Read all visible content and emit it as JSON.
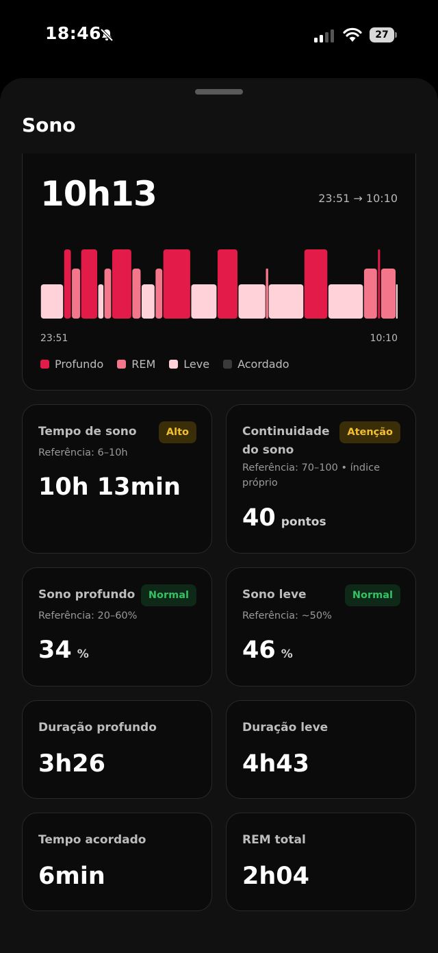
{
  "status_bar": {
    "time": "18:46",
    "battery": "27",
    "icons": [
      "bell-slash-icon",
      "signal-icon",
      "wifi-icon",
      "battery-icon"
    ]
  },
  "sheet": {
    "title": "Sono"
  },
  "summary": {
    "duration": "10h13",
    "range": "23:51 → 10:10",
    "start_label": "23:51",
    "end_label": "10:10",
    "legend": [
      {
        "label": "Profundo",
        "color": "#E31B48"
      },
      {
        "label": "REM",
        "color": "#F4768B"
      },
      {
        "label": "Leve",
        "color": "#FFD1D9"
      },
      {
        "label": "Acordado",
        "color": "#3A3A3A"
      }
    ]
  },
  "hypnogram": [
    {
      "s": "leve",
      "d": 30
    },
    {
      "s": "profundo",
      "d": 10
    },
    {
      "s": "rem",
      "d": 12
    },
    {
      "s": "profundo",
      "d": 22
    },
    {
      "s": "leve",
      "d": 8
    },
    {
      "s": "rem",
      "d": 10
    },
    {
      "s": "profundo",
      "d": 26
    },
    {
      "s": "rem",
      "d": 12
    },
    {
      "s": "leve",
      "d": 18
    },
    {
      "s": "rem",
      "d": 10
    },
    {
      "s": "profundo",
      "d": 36
    },
    {
      "s": "leve",
      "d": 34
    },
    {
      "s": "profundo",
      "d": 27
    },
    {
      "s": "leve",
      "d": 36
    },
    {
      "s": "rem",
      "d": 3
    },
    {
      "s": "leve",
      "d": 46
    },
    {
      "s": "profundo",
      "d": 31
    },
    {
      "s": "leve",
      "d": 46
    },
    {
      "s": "rem",
      "d": 18
    },
    {
      "s": "profundo",
      "d": 4
    },
    {
      "s": "rem",
      "d": 20
    },
    {
      "s": "leve",
      "d": 2
    }
  ],
  "metrics": [
    {
      "label": "Tempo de sono",
      "badge": "Alto",
      "badge_type": "warn",
      "reference": "Referência: 6–10h",
      "value": "10h 13min",
      "unit": ""
    },
    {
      "label": "Continuidade do sono",
      "badge": "Atenção",
      "badge_type": "warn",
      "reference": "Referência: 70–100 • índice próprio",
      "value": "40",
      "unit": "pontos"
    },
    {
      "label": "Sono profundo",
      "badge": "Normal",
      "badge_type": "ok",
      "reference": "Referência: 20–60%",
      "value": "34",
      "unit": "%"
    },
    {
      "label": "Sono leve",
      "badge": "Normal",
      "badge_type": "ok",
      "reference": "Referência: ~50%",
      "value": "46",
      "unit": "%"
    },
    {
      "label": "Duração profundo",
      "value": "3h26"
    },
    {
      "label": "Duração leve",
      "value": "4h43"
    },
    {
      "label": "Tempo acordado",
      "value": "6min"
    },
    {
      "label": "REM total",
      "value": "2h04"
    }
  ]
}
